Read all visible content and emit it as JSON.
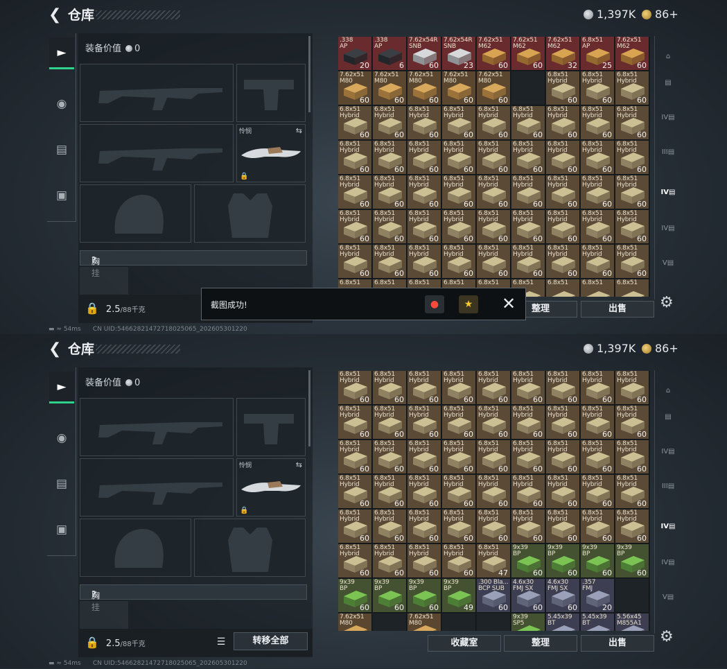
{
  "header": {
    "back_icon": "back-arrow-icon",
    "title": "仓库",
    "silver": "1,397K",
    "gold": "86+"
  },
  "sidebar": {
    "tabs": [
      {
        "icon": "gun-icon"
      },
      {
        "icon": "helmet-icon"
      },
      {
        "icon": "backpack-icon"
      },
      {
        "icon": "briefcase-icon"
      }
    ]
  },
  "equipment": {
    "value_label": "装备价值",
    "value": "0",
    "melee_label": "怜悯",
    "vest_label": "胸挂",
    "weight": "2.5",
    "capacity": "/88千克",
    "transfer_all": "转移全部"
  },
  "buttons": {
    "collection": "收藏室",
    "organize": "整理",
    "sell": "出售"
  },
  "status_bar": {
    "ping": "54ms",
    "uid": "CN UID:546628214727180250​65_202605301220"
  },
  "toast": {
    "message": "截图成功!"
  },
  "right_tabs": [
    "",
    "",
    "IV",
    "III",
    "IV",
    "IV",
    "V"
  ],
  "grid_top": [
    [
      {
        "n": ".338\nAP",
        "q": "20",
        "c": "ap"
      },
      {
        "n": ".338\nAP",
        "q": "6",
        "c": "ap"
      },
      {
        "n": "7.62x54R\nSNB",
        "q": "60",
        "c": "w"
      },
      {
        "n": "7.62x54R\nSNB",
        "q": "23",
        "c": "w"
      },
      {
        "n": "7.62x51\nM62",
        "q": "60",
        "c": "r"
      },
      {
        "n": "7.62x51\nM62",
        "q": "60",
        "c": "r"
      },
      {
        "n": "7.62x51\nM62",
        "q": "32",
        "c": "r"
      },
      {
        "n": "6.8x51\nAP",
        "q": "25",
        "c": "r"
      },
      {
        "n": "7.62x51\nM62",
        "q": "60",
        "c": "r"
      }
    ],
    [
      {
        "n": "7.62x51\nM80",
        "q": "60",
        "c": "o"
      },
      {
        "n": "7.62x51\nM80",
        "q": "60",
        "c": "o"
      },
      {
        "n": "7.62x51\nM80",
        "q": "60",
        "c": "o"
      },
      {
        "n": "7.62x51\nM80",
        "q": "60",
        "c": "o"
      },
      {
        "n": "7.62x51\nM80",
        "q": "60",
        "c": "o"
      },
      {
        "n": "",
        "q": "",
        "c": "e"
      },
      {
        "n": "6.8x51\nHybrid",
        "q": "60",
        "c": "h"
      },
      {
        "n": "6.8x51\nHybrid",
        "q": "60",
        "c": "h"
      },
      {
        "n": "6.8x51\nHybrid",
        "q": "60",
        "c": "h"
      }
    ],
    [
      {
        "n": "6.8x51\nHybrid",
        "q": "60",
        "c": "h"
      },
      {
        "n": "6.8x51\nHybrid",
        "q": "60",
        "c": "h"
      },
      {
        "n": "6.8x51\nHybrid",
        "q": "60",
        "c": "h"
      },
      {
        "n": "6.8x51\nHybrid",
        "q": "60",
        "c": "h"
      },
      {
        "n": "6.8x51\nHybrid",
        "q": "60",
        "c": "h"
      },
      {
        "n": "6.8x51\nHybrid",
        "q": "60",
        "c": "h"
      },
      {
        "n": "6.8x51\nHybrid",
        "q": "60",
        "c": "h"
      },
      {
        "n": "6.8x51\nHybrid",
        "q": "60",
        "c": "h"
      },
      {
        "n": "6.8x51\nHybrid",
        "q": "60",
        "c": "h"
      }
    ],
    [
      {
        "n": "6.8x51\nHybrid",
        "q": "60",
        "c": "h"
      },
      {
        "n": "6.8x51\nHybrid",
        "q": "60",
        "c": "h"
      },
      {
        "n": "6.8x51\nHybrid",
        "q": "60",
        "c": "h"
      },
      {
        "n": "6.8x51\nHybrid",
        "q": "60",
        "c": "h"
      },
      {
        "n": "6.8x51\nHybrid",
        "q": "60",
        "c": "h"
      },
      {
        "n": "6.8x51\nHybrid",
        "q": "60",
        "c": "h"
      },
      {
        "n": "6.8x51\nHybrid",
        "q": "60",
        "c": "h"
      },
      {
        "n": "6.8x51\nHybrid",
        "q": "60",
        "c": "h"
      },
      {
        "n": "6.8x51\nHybrid",
        "q": "60",
        "c": "h"
      }
    ],
    [
      {
        "n": "6.8x51\nHybrid",
        "q": "60",
        "c": "h"
      },
      {
        "n": "6.8x51\nHybrid",
        "q": "60",
        "c": "h"
      },
      {
        "n": "6.8x51\nHybrid",
        "q": "60",
        "c": "h"
      },
      {
        "n": "6.8x51\nHybrid",
        "q": "60",
        "c": "h"
      },
      {
        "n": "6.8x51\nHybrid",
        "q": "60",
        "c": "h"
      },
      {
        "n": "6.8x51\nHybrid",
        "q": "60",
        "c": "h"
      },
      {
        "n": "6.8x51\nHybrid",
        "q": "60",
        "c": "h"
      },
      {
        "n": "6.8x51\nHybrid",
        "q": "60",
        "c": "h"
      },
      {
        "n": "6.8x51\nHybrid",
        "q": "60",
        "c": "h"
      }
    ],
    [
      {
        "n": "6.8x51\nHybrid",
        "q": "60",
        "c": "h"
      },
      {
        "n": "6.8x51\nHybrid",
        "q": "60",
        "c": "h"
      },
      {
        "n": "6.8x51\nHybrid",
        "q": "60",
        "c": "h"
      },
      {
        "n": "6.8x51\nHybrid",
        "q": "60",
        "c": "h"
      },
      {
        "n": "6.8x51\nHybrid",
        "q": "60",
        "c": "h"
      },
      {
        "n": "6.8x51\nHybrid",
        "q": "60",
        "c": "h"
      },
      {
        "n": "6.8x51\nHybrid",
        "q": "60",
        "c": "h"
      },
      {
        "n": "6.8x51\nHybrid",
        "q": "60",
        "c": "h"
      },
      {
        "n": "6.8x51\nHybrid",
        "q": "60",
        "c": "h"
      }
    ],
    [
      {
        "n": "6.8x51\nHybrid",
        "q": "60",
        "c": "h"
      },
      {
        "n": "6.8x51\nHybrid",
        "q": "60",
        "c": "h"
      },
      {
        "n": "6.8x51\nHybrid",
        "q": "60",
        "c": "h"
      },
      {
        "n": "6.8x51\nHybrid",
        "q": "60",
        "c": "h"
      },
      {
        "n": "6.8x51\nHybrid",
        "q": "60",
        "c": "h"
      },
      {
        "n": "6.8x51\nHybrid",
        "q": "60",
        "c": "h"
      },
      {
        "n": "6.8x51\nHybrid",
        "q": "60",
        "c": "h"
      },
      {
        "n": "6.8x51\nHybrid",
        "q": "60",
        "c": "h"
      },
      {
        "n": "6.8x51\nHybrid",
        "q": "60",
        "c": "h"
      }
    ],
    [
      {
        "n": "6.8x51",
        "q": "",
        "c": "h"
      },
      {
        "n": "6.8x51",
        "q": "",
        "c": "h"
      },
      {
        "n": "6.8x51",
        "q": "",
        "c": "h"
      },
      {
        "n": "6.8x51",
        "q": "",
        "c": "h"
      },
      {
        "n": "6.8x51",
        "q": "",
        "c": "h"
      },
      {
        "n": "6.8x51",
        "q": "",
        "c": "h"
      },
      {
        "n": "6.8x51",
        "q": "",
        "c": "h"
      },
      {
        "n": "6.8x51",
        "q": "",
        "c": "h"
      },
      {
        "n": "6.8x51",
        "q": "",
        "c": "h"
      }
    ]
  ],
  "grid_bottom": [
    [
      {
        "n": "6.8x51\nHybrid",
        "q": "60",
        "c": "h"
      },
      {
        "n": "6.8x51\nHybrid",
        "q": "60",
        "c": "h"
      },
      {
        "n": "6.8x51\nHybrid",
        "q": "60",
        "c": "h"
      },
      {
        "n": "6.8x51\nHybrid",
        "q": "60",
        "c": "h"
      },
      {
        "n": "6.8x51\nHybrid",
        "q": "60",
        "c": "h"
      },
      {
        "n": "6.8x51\nHybrid",
        "q": "60",
        "c": "h"
      },
      {
        "n": "6.8x51\nHybrid",
        "q": "60",
        "c": "h"
      },
      {
        "n": "6.8x51\nHybrid",
        "q": "60",
        "c": "h"
      },
      {
        "n": "6.8x51\nHybrid",
        "q": "60",
        "c": "h"
      }
    ],
    [
      {
        "n": "6.8x51\nHybrid",
        "q": "60",
        "c": "h"
      },
      {
        "n": "6.8x51\nHybrid",
        "q": "60",
        "c": "h"
      },
      {
        "n": "6.8x51\nHybrid",
        "q": "60",
        "c": "h"
      },
      {
        "n": "6.8x51\nHybrid",
        "q": "60",
        "c": "h"
      },
      {
        "n": "6.8x51\nHybrid",
        "q": "60",
        "c": "h"
      },
      {
        "n": "6.8x51\nHybrid",
        "q": "60",
        "c": "h"
      },
      {
        "n": "6.8x51\nHybrid",
        "q": "60",
        "c": "h"
      },
      {
        "n": "6.8x51\nHybrid",
        "q": "60",
        "c": "h"
      },
      {
        "n": "6.8x51\nHybrid",
        "q": "60",
        "c": "h"
      }
    ],
    [
      {
        "n": "6.8x51\nHybrid",
        "q": "60",
        "c": "h"
      },
      {
        "n": "6.8x51\nHybrid",
        "q": "60",
        "c": "h"
      },
      {
        "n": "6.8x51\nHybrid",
        "q": "60",
        "c": "h"
      },
      {
        "n": "6.8x51\nHybrid",
        "q": "60",
        "c": "h"
      },
      {
        "n": "6.8x51\nHybrid",
        "q": "60",
        "c": "h"
      },
      {
        "n": "6.8x51\nHybrid",
        "q": "60",
        "c": "h"
      },
      {
        "n": "6.8x51\nHybrid",
        "q": "60",
        "c": "h"
      },
      {
        "n": "6.8x51\nHybrid",
        "q": "60",
        "c": "h"
      },
      {
        "n": "6.8x51\nHybrid",
        "q": "60",
        "c": "h"
      }
    ],
    [
      {
        "n": "6.8x51\nHybrid",
        "q": "60",
        "c": "h"
      },
      {
        "n": "6.8x51\nHybrid",
        "q": "60",
        "c": "h"
      },
      {
        "n": "6.8x51\nHybrid",
        "q": "60",
        "c": "h"
      },
      {
        "n": "6.8x51\nHybrid",
        "q": "60",
        "c": "h"
      },
      {
        "n": "6.8x51\nHybrid",
        "q": "60",
        "c": "h"
      },
      {
        "n": "6.8x51\nHybrid",
        "q": "60",
        "c": "h"
      },
      {
        "n": "6.8x51\nHybrid",
        "q": "60",
        "c": "h"
      },
      {
        "n": "6.8x51\nHybrid",
        "q": "60",
        "c": "h"
      },
      {
        "n": "6.8x51\nHybrid",
        "q": "60",
        "c": "h"
      }
    ],
    [
      {
        "n": "6.8x51\nHybrid",
        "q": "60",
        "c": "h"
      },
      {
        "n": "6.8x51\nHybrid",
        "q": "60",
        "c": "h"
      },
      {
        "n": "6.8x51\nHybrid",
        "q": "60",
        "c": "h"
      },
      {
        "n": "6.8x51\nHybrid",
        "q": "60",
        "c": "h"
      },
      {
        "n": "6.8x51\nHybrid",
        "q": "60",
        "c": "h"
      },
      {
        "n": "6.8x51\nHybrid",
        "q": "60",
        "c": "h"
      },
      {
        "n": "6.8x51\nHybrid",
        "q": "60",
        "c": "h"
      },
      {
        "n": "6.8x51\nHybrid",
        "q": "60",
        "c": "h"
      },
      {
        "n": "6.8x51\nHybrid",
        "q": "60",
        "c": "h"
      }
    ],
    [
      {
        "n": "6.8x51\nHybrid",
        "q": "60",
        "c": "h"
      },
      {
        "n": "6.8x51\nHybrid",
        "q": "60",
        "c": "h"
      },
      {
        "n": "6.8x51\nHybrid",
        "q": "60",
        "c": "h"
      },
      {
        "n": "6.8x51\nHybrid",
        "q": "60",
        "c": "h"
      },
      {
        "n": "6.8x51\nHybrid",
        "q": "47",
        "c": "h"
      },
      {
        "n": "9x39\nBP",
        "q": "60",
        "c": "g"
      },
      {
        "n": "9x39\nBP",
        "q": "60",
        "c": "g"
      },
      {
        "n": "9x39\nBP",
        "q": "60",
        "c": "g"
      },
      {
        "n": "9x39\nBP",
        "q": "60",
        "c": "g"
      }
    ],
    [
      {
        "n": "9x39\nBP",
        "q": "60",
        "c": "g"
      },
      {
        "n": "9x39\nBP",
        "q": "60",
        "c": "g"
      },
      {
        "n": "9x39\nBP",
        "q": "60",
        "c": "g"
      },
      {
        "n": "9x39\nBP",
        "q": "49",
        "c": "g"
      },
      {
        "n": ".300 Bla...\nBCP SUB",
        "q": "60",
        "c": "b"
      },
      {
        "n": "4.6x30\nFMJ SX",
        "q": "60",
        "c": "b"
      },
      {
        "n": "4.6x30\nFMJ SX",
        "q": "60",
        "c": "b"
      },
      {
        "n": ".357\nFMJ",
        "q": "20",
        "c": "b"
      },
      {
        "n": "",
        "q": "",
        "c": "e"
      }
    ],
    [
      {
        "n": "7.62x51\nM80",
        "q": "",
        "c": "o"
      },
      {
        "n": "",
        "q": "",
        "c": "e"
      },
      {
        "n": "7.62x51\nM80",
        "q": "",
        "c": "o"
      },
      {
        "n": "",
        "q": "",
        "c": "e"
      },
      {
        "n": "",
        "q": "",
        "c": "e"
      },
      {
        "n": "9x39\nSP5",
        "q": "",
        "c": "g"
      },
      {
        "n": "5.45x39\nBT",
        "q": "",
        "c": "b"
      },
      {
        "n": "5.45x39\nBT",
        "q": "",
        "c": "b"
      },
      {
        "n": "5.56x45\nM855A1",
        "q": "",
        "c": "b"
      }
    ]
  ]
}
